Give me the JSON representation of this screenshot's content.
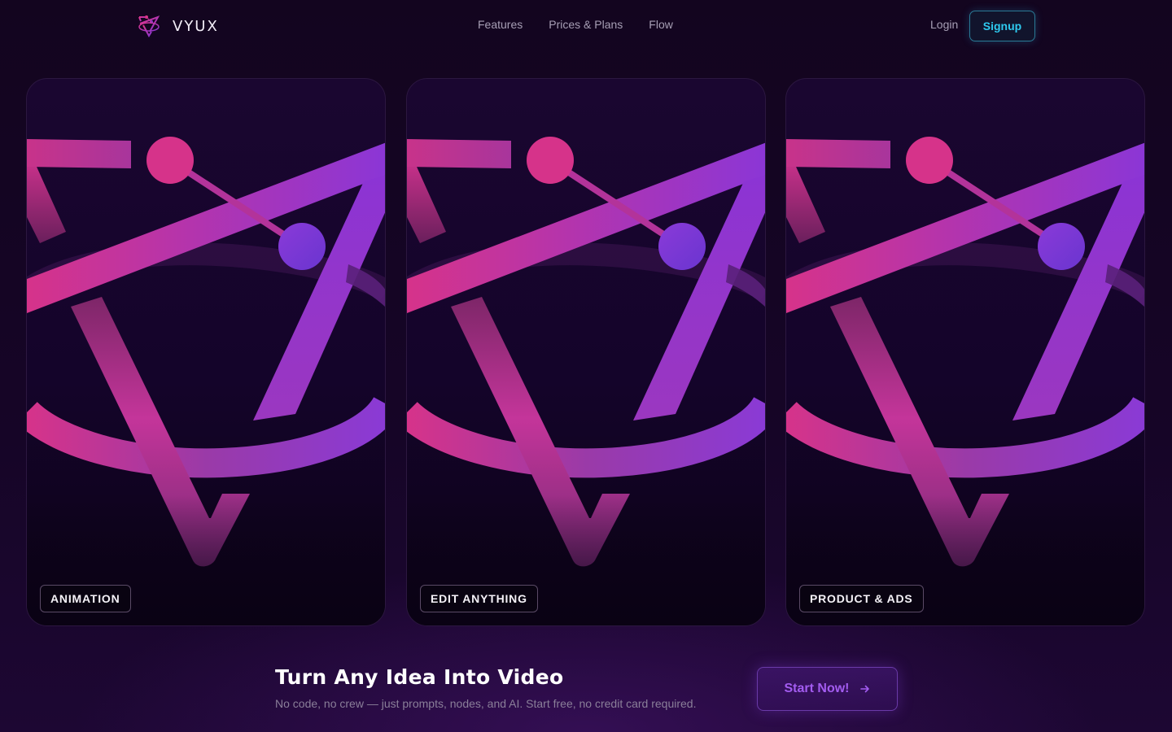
{
  "brand": {
    "name": "VYUX",
    "logo_icon": "vyux-logo-icon"
  },
  "nav": {
    "links": [
      {
        "label": "Features"
      },
      {
        "label": "Prices & Plans"
      },
      {
        "label": "Flow"
      }
    ],
    "login_label": "Login",
    "signup_label": "Signup"
  },
  "cards": [
    {
      "tag": "ANIMATION"
    },
    {
      "tag": "EDIT ANYTHING"
    },
    {
      "tag": "PRODUCT & ADS"
    }
  ],
  "cta": {
    "title": "Turn Any Idea Into Video",
    "subtitle": "No code, no crew — just prompts, nodes, and AI. Start free, no credit card required.",
    "button_label": "Start Now!",
    "button_icon": "arrow-right-icon"
  },
  "colors": {
    "background": "#13051f",
    "accent_pink": "#d63384",
    "accent_purple": "#8a35d4",
    "signup_cyan": "#2ec9ee",
    "cta_purple": "#a35cf0"
  }
}
